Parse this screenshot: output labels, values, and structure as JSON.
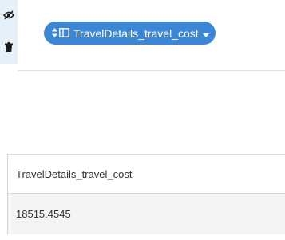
{
  "toolbar": {
    "icons": [
      "eye-slash-icon",
      "trash-icon"
    ]
  },
  "field_pill": {
    "label": "TravelDetails_travel_cost",
    "icons": [
      "sort-arrows-icon",
      "column-layout-icon",
      "caret-down-icon"
    ],
    "color": "#3b87d6"
  },
  "table": {
    "columns": [
      "TravelDetails_travel_cost"
    ],
    "rows": [
      [
        "18515.4545"
      ]
    ]
  }
}
